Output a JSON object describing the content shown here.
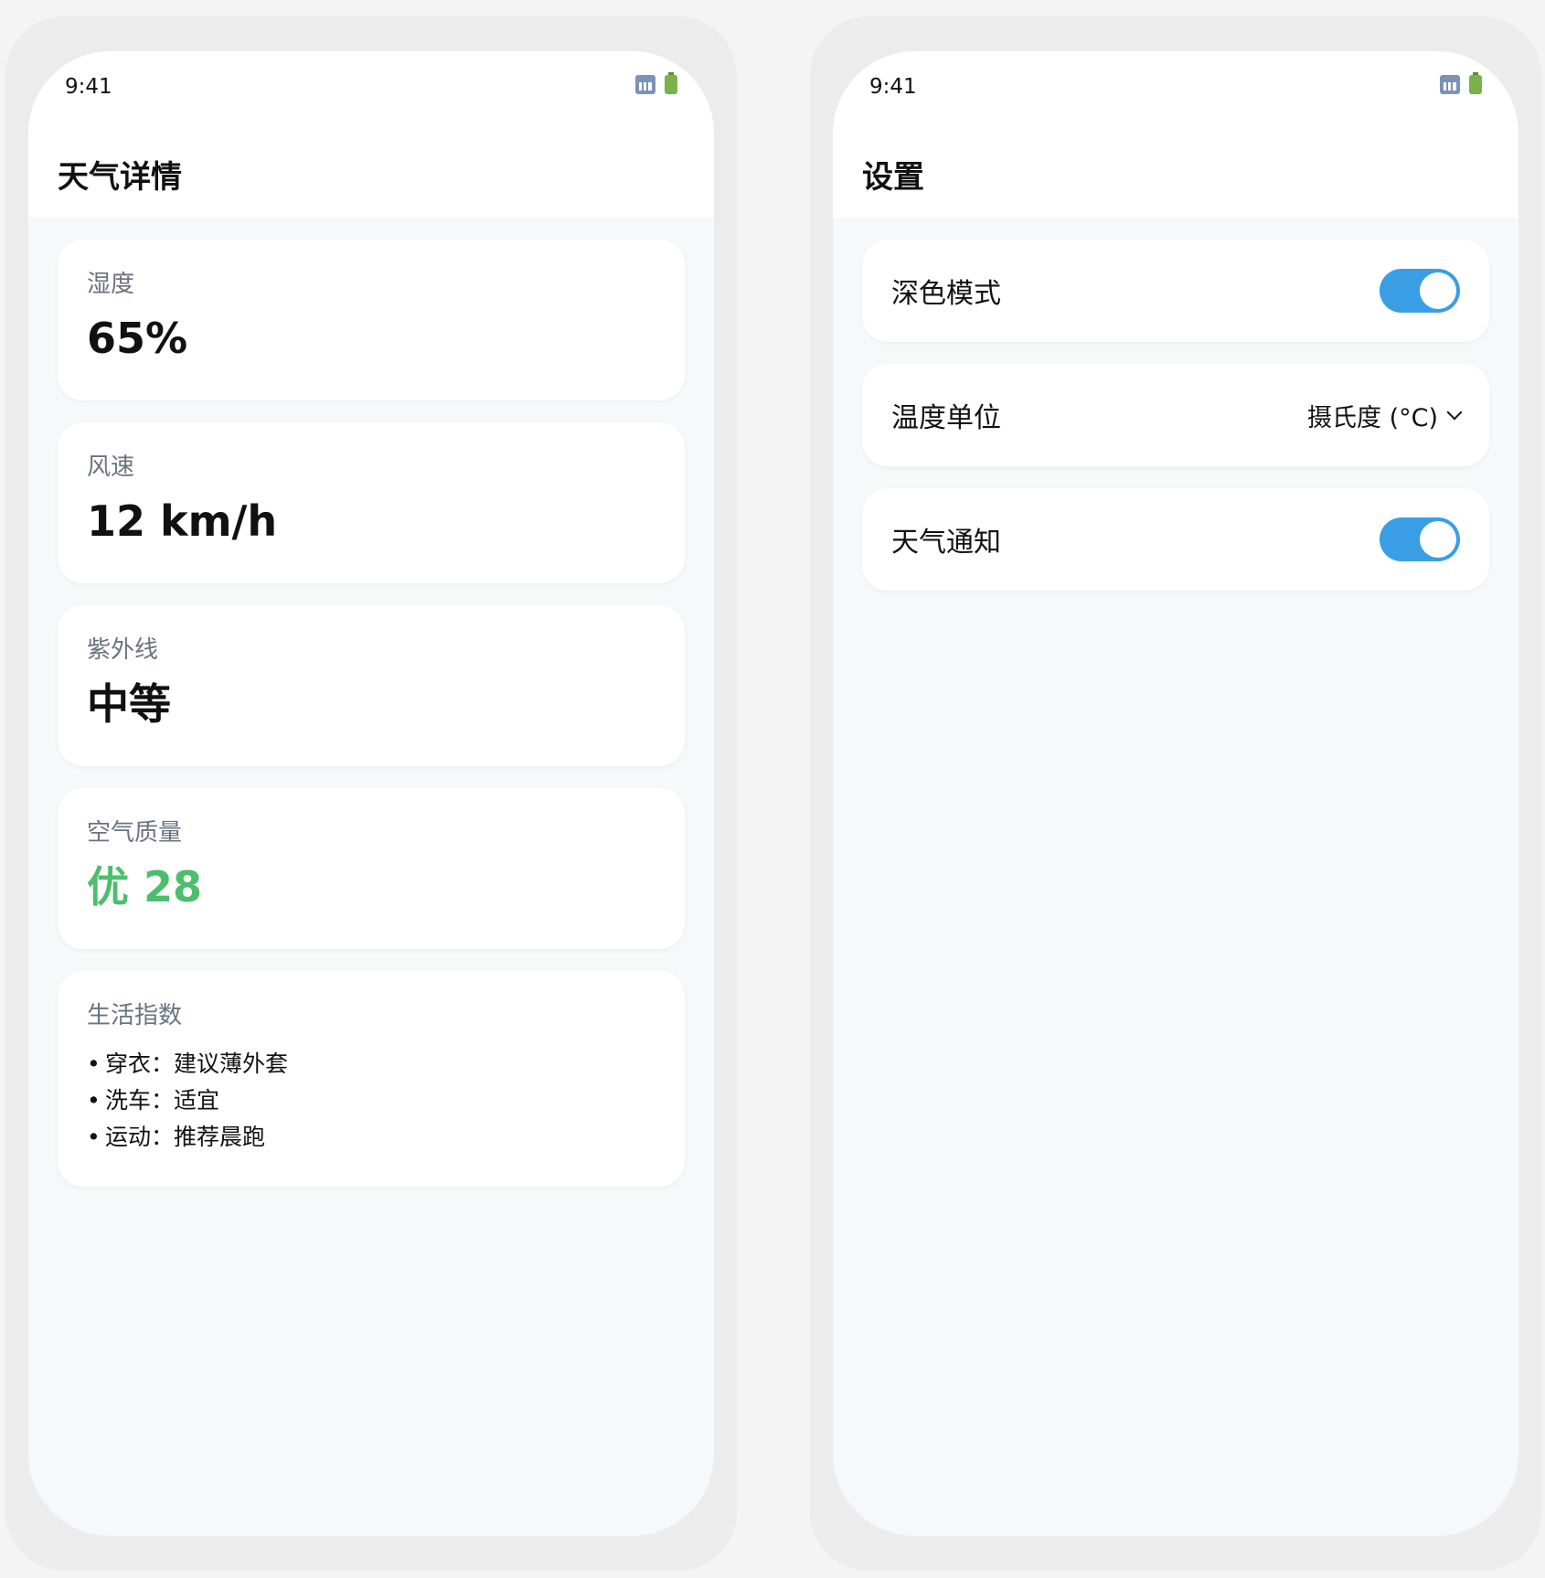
{
  "status_bar": {
    "time": "9:41"
  },
  "weather_detail": {
    "title": "天气详情",
    "metrics": [
      {
        "label": "湿度",
        "value": "65%"
      },
      {
        "label": "风速",
        "value": "12 km/h"
      },
      {
        "label": "紫外线",
        "value": "中等"
      },
      {
        "label": "空气质量",
        "value": "优 28",
        "color": "#4bbf6b"
      }
    ],
    "life_index": {
      "label": "生活指数",
      "items": [
        "穿衣：建议薄外套",
        "洗车：适宜",
        "运动：推荐晨跑"
      ]
    }
  },
  "settings": {
    "title": "设置",
    "dark_mode": {
      "label": "深色模式",
      "enabled": true
    },
    "temperature_unit": {
      "label": "温度单位",
      "value": "摄氏度 (°C)"
    },
    "weather_notifications": {
      "label": "天气通知",
      "enabled": true
    }
  },
  "colors": {
    "accent": "#3a9ee4",
    "good": "#4bbf6b"
  }
}
